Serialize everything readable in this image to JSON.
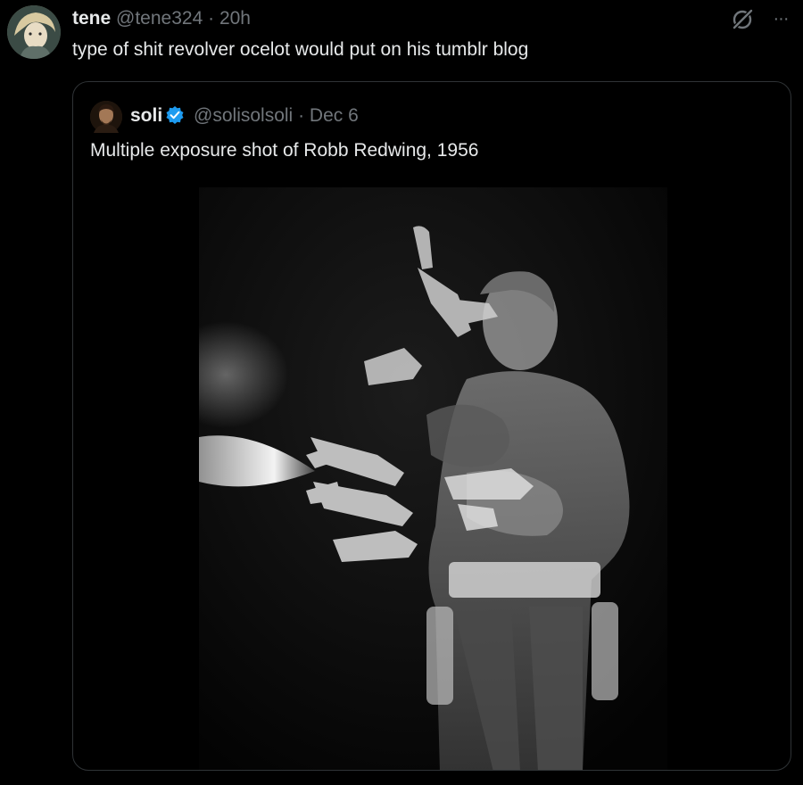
{
  "tweet": {
    "display_name": "tene",
    "handle": "@tene324",
    "separator": "·",
    "time": "20h",
    "text": "type of shit revolver ocelot would put on his tumblr blog",
    "more_label": "···"
  },
  "quote": {
    "display_name": "soli",
    "verified": true,
    "handle": "@solisolsoli",
    "separator": "·",
    "date": "Dec 6",
    "text": "Multiple exposure shot of Robb Redwing, 1956"
  },
  "colors": {
    "background": "#000000",
    "primary_text": "#e7e9ea",
    "secondary_text": "#71767b",
    "border": "#2f3336",
    "verified_blue": "#1d9bf0"
  },
  "icons": {
    "grok": "grok-icon",
    "more": "more-icon",
    "verified": "verified-badge-icon"
  }
}
